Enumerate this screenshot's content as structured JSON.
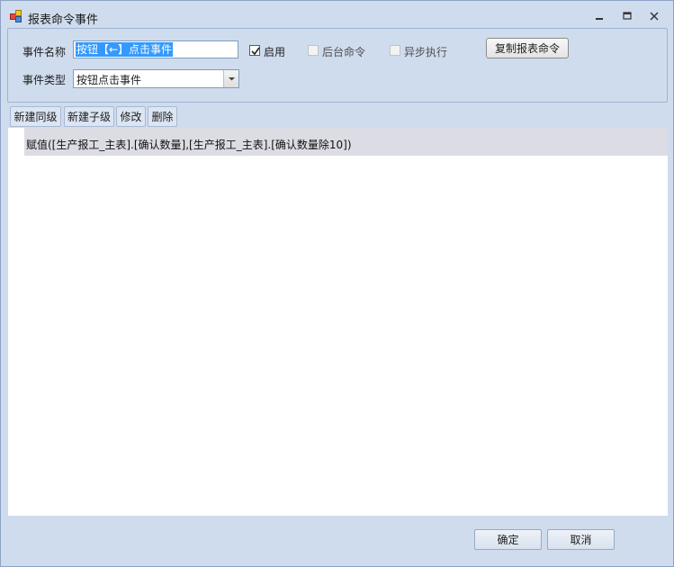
{
  "window": {
    "title": "报表命令事件",
    "icon": "app-window-icon"
  },
  "form": {
    "name_label": "事件名称",
    "name_value": "按钮【←】点击事件",
    "enable_label": "启用",
    "enable_checked": true,
    "background_label": "后台命令",
    "background_checked": false,
    "async_label": "异步执行",
    "async_checked": false,
    "copy_button": "复制报表命令",
    "type_label": "事件类型",
    "type_value": "按钮点击事件"
  },
  "toolbar": {
    "new_sibling": "新建同级",
    "new_child": "新建子级",
    "edit": "修改",
    "delete": "删除"
  },
  "commands": [
    "赋值([生产报工_主表].[确认数量],[生产报工_主表].[确认数量除10])"
  ],
  "footer": {
    "ok": "确定",
    "cancel": "取消"
  }
}
